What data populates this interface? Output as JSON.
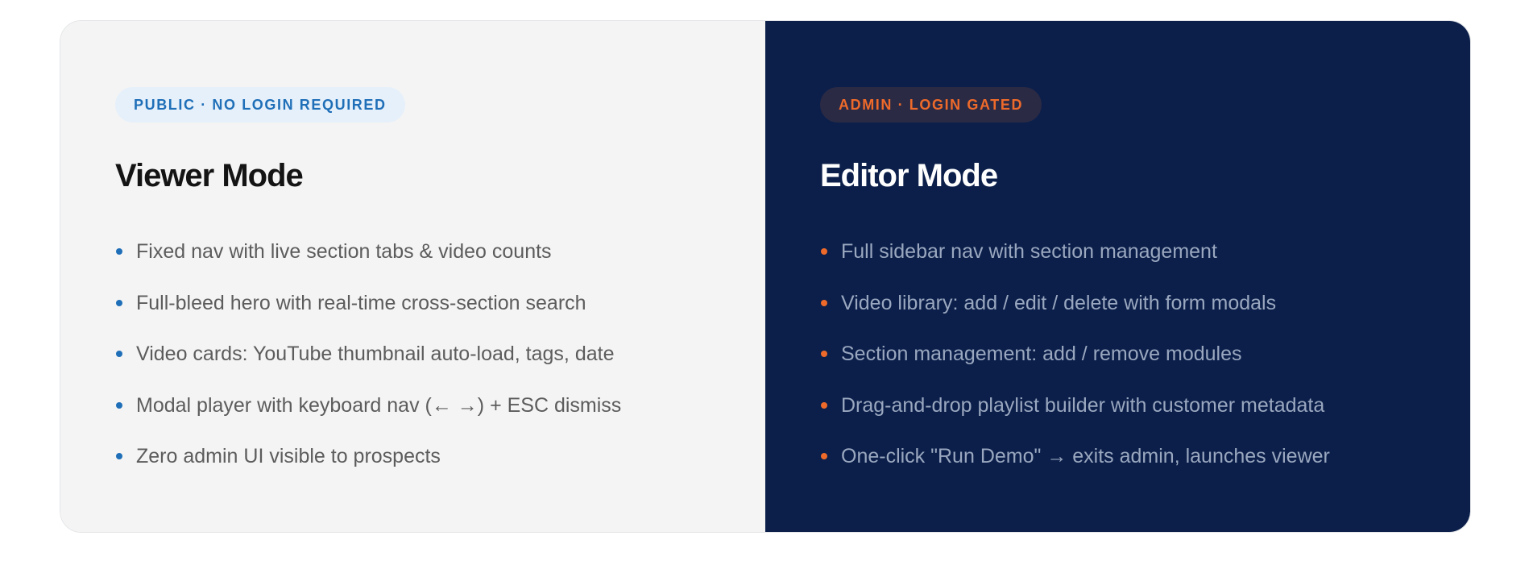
{
  "viewer": {
    "badge": "PUBLIC · NO LOGIN REQUIRED",
    "title": "Viewer Mode",
    "items": [
      "Fixed nav with live section tabs & video counts",
      "Full-bleed hero with real-time cross-section search",
      "Video cards: YouTube thumbnail auto-load, tags, date",
      "Modal player with keyboard nav (← →) + ESC dismiss",
      "Zero admin UI visible to prospects"
    ],
    "colors": {
      "background": "#f4f4f4",
      "accent": "#1f6fb8"
    }
  },
  "editor": {
    "badge": "ADMIN · LOGIN GATED",
    "title": "Editor Mode",
    "items": [
      "Full sidebar nav with section management",
      "Video library: add / edit / delete with form modals",
      "Section management: add / remove modules",
      "Drag-and-drop playlist builder with customer metadata",
      "One-click \"Run Demo\" → exits admin, launches viewer"
    ],
    "colors": {
      "background": "#0b1f4a",
      "accent": "#ee6a2a"
    }
  }
}
